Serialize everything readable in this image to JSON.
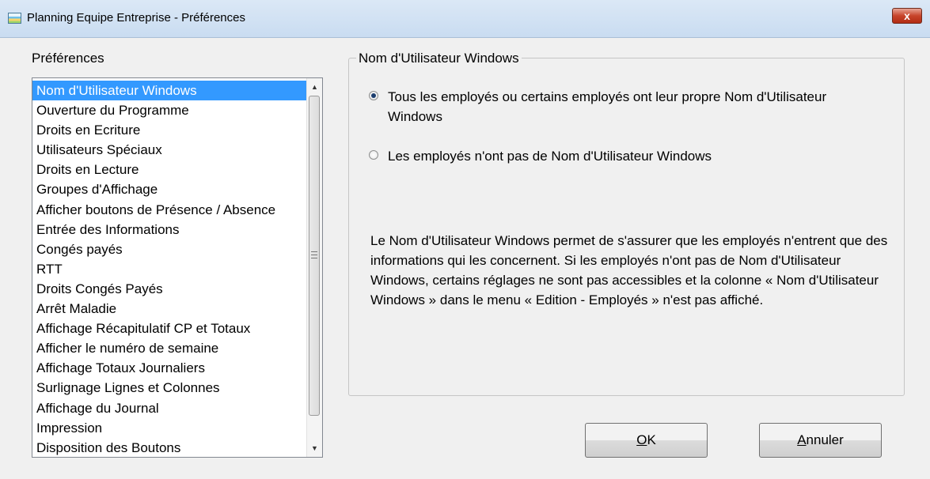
{
  "window": {
    "title": "Planning Equipe Entreprise - Préférences",
    "close_glyph": "x"
  },
  "sidebar": {
    "label": "Préférences",
    "items": [
      "Nom d'Utilisateur Windows",
      "Ouverture du Programme",
      "Droits en Ecriture",
      "Utilisateurs Spéciaux",
      "Droits en Lecture",
      "Groupes d'Affichage",
      "Afficher boutons de Présence / Absence",
      "Entrée des Informations",
      "Congés payés",
      "RTT",
      "Droits Congés Payés",
      "Arrêt Maladie",
      "Affichage Récapitulatif CP et Totaux",
      "Afficher le numéro de semaine",
      "Affichage Totaux Journaliers",
      "Surlignage Lignes et Colonnes",
      "Affichage du Journal",
      "Impression",
      "Disposition des Boutons"
    ],
    "selected_index": 0
  },
  "panel": {
    "group_title": "Nom d'Utilisateur Windows",
    "option_own": "Tous les employés ou certains employés ont leur propre Nom d'Utilisateur Windows",
    "option_none": "Les employés n'ont pas de Nom d'Utilisateur Windows",
    "selected_option": "option_own",
    "description": "Le Nom d'Utilisateur Windows permet de s'assurer que les employés n'entrent que des informations qui les concernent. Si les employés n'ont pas de Nom d'Utilisateur Windows, certains réglages ne sont pas accessibles et la colonne « Nom d'Utilisateur Windows » dans le menu « Edition - Employés » n'est pas affiché."
  },
  "buttons": {
    "ok_mnemonic": "O",
    "ok_rest": "K",
    "cancel_mnemonic": "A",
    "cancel_rest": "nnuler"
  },
  "colors": {
    "selection": "#3399ff",
    "dialog_bg": "#f0f0f0"
  }
}
